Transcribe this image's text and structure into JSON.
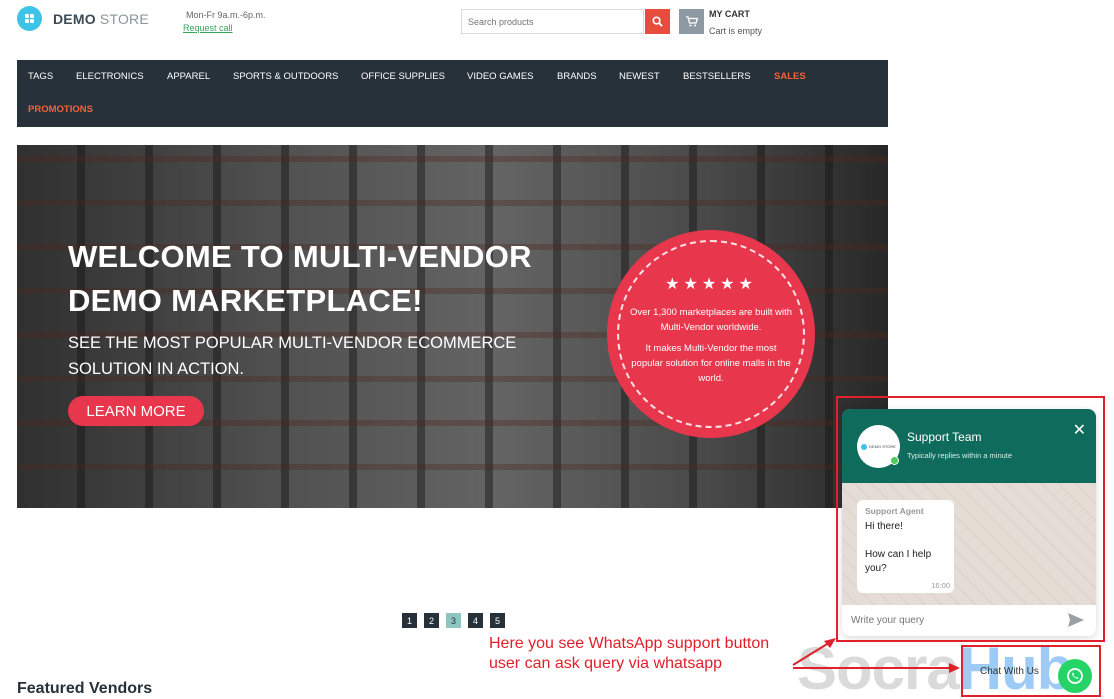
{
  "header": {
    "logo_bold": "DEMO",
    "logo_light": " STORE",
    "hours": "Mon-Fr 9a.m.-6p.m.",
    "request_call": "Request call",
    "search_placeholder": "Search products",
    "cart_title": "MY CART",
    "cart_status": "Cart is empty"
  },
  "nav": {
    "items": [
      "TAGS",
      "ELECTRONICS",
      "APPAREL",
      "SPORTS & OUTDOORS",
      "OFFICE SUPPLIES",
      "VIDEO GAMES",
      "BRANDS",
      "NEWEST",
      "BESTSELLERS",
      "SALES",
      "PROMOTIONS"
    ],
    "highlight_color": "#f4623a",
    "background": "#26313a"
  },
  "banner": {
    "title_line1": "WELCOME TO MULTI-VENDOR",
    "title_line2": "DEMO MARKETPLACE!",
    "subtitle_line1": "SEE THE MOST POPULAR MULTI-VENDOR ECOMMERCE",
    "subtitle_line2": "SOLUTION IN ACTION.",
    "cta": "LEARN MORE",
    "badge_stars": "★★★★★",
    "badge_line1": "Over 1,300 marketplaces are built with Multi-Vendor worldwide.",
    "badge_line2": "It makes Multi-Vendor the most popular solution for online malls in the world.",
    "accent": "#e8364c"
  },
  "pagination": {
    "pages": [
      "1",
      "2",
      "3",
      "4",
      "5"
    ],
    "active": "3"
  },
  "featured_vendors": "Featured Vendors",
  "chat": {
    "title": "Support Team",
    "subtitle": "Typically replies within a minute",
    "avatar_text": "DEMO STORE",
    "agent": "Support Agent",
    "message": "Hi there!\n\nHow can I help you?",
    "time": "16:00",
    "input_placeholder": "Write your query",
    "header_color": "#0f6b5c"
  },
  "chat_button": {
    "label": "Chat With Us"
  },
  "annotation": {
    "line1": "Here you see WhatsApp support button",
    "line2": "user can ask query via whatsapp",
    "color": "#e0202a"
  },
  "watermark": {
    "part1": "Socra",
    "part2": "Hub"
  }
}
